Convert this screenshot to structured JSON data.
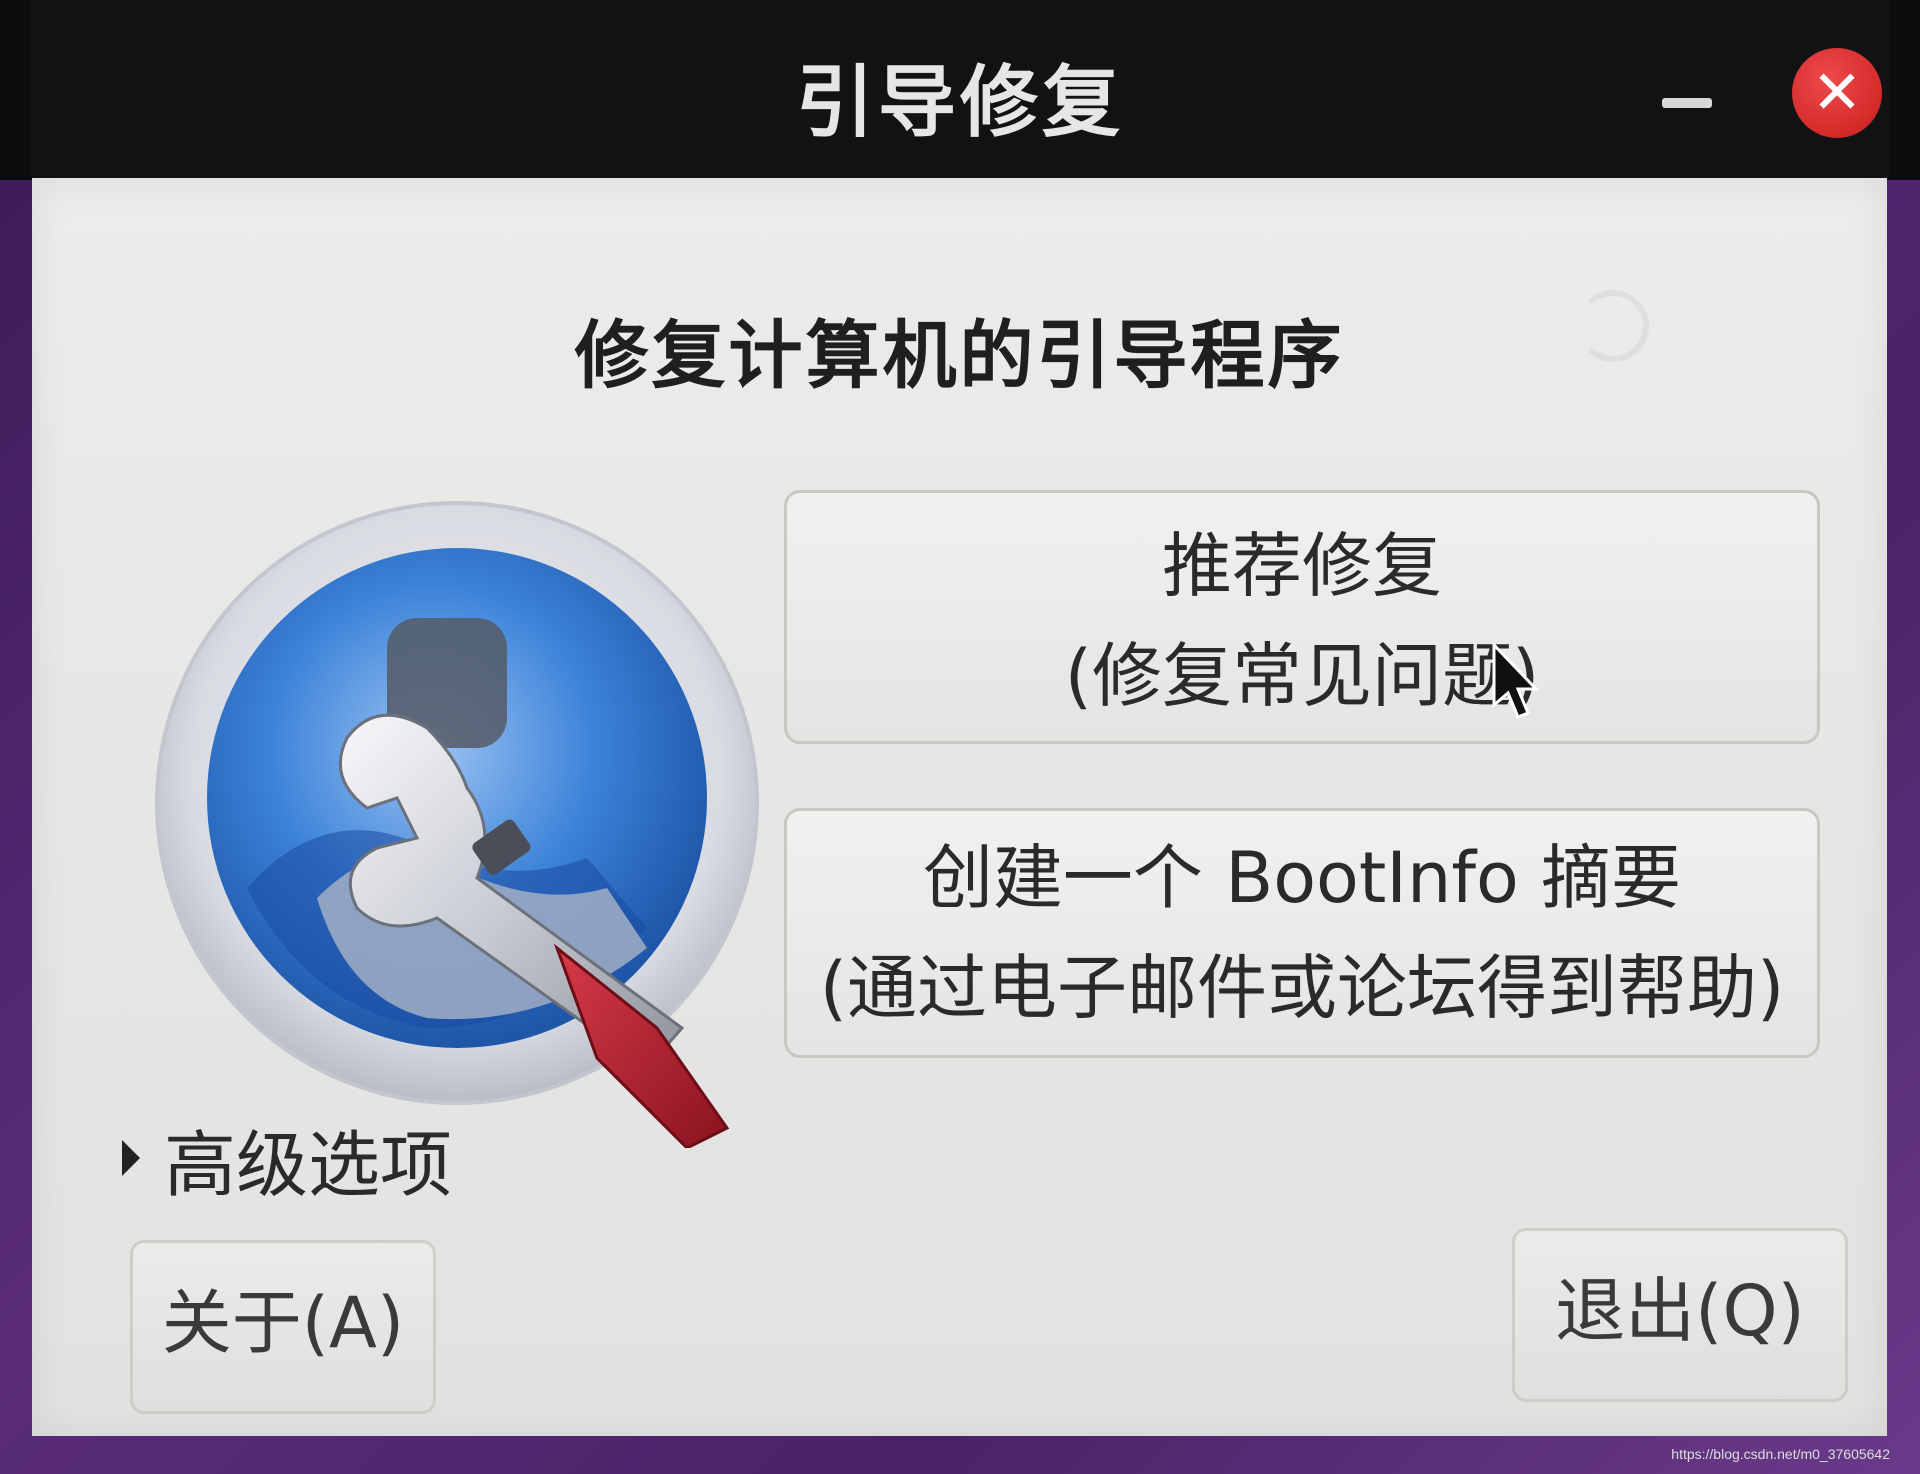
{
  "window": {
    "title": "引导修复"
  },
  "dialog": {
    "heading": "修复计算机的引导程序",
    "recommended_repair": {
      "line1": "推荐修复",
      "line2": "(修复常见问题)"
    },
    "bootinfo_summary": {
      "line1": "创建一个 BootInfo 摘要",
      "line2": "(通过电子邮件或论坛得到帮助)"
    },
    "advanced_options_label": "高级选项",
    "about_label": "关于(A)",
    "quit_label": "退出(Q)"
  },
  "watermark": "https://blog.csdn.net/m0_37605642",
  "icons": {
    "minimize": "minimize-icon",
    "close": "close-icon",
    "app_logo": "wrench-disc-icon",
    "expander": "expander-triangle-icon",
    "spinner": "spinner-icon",
    "cursor": "mouse-cursor-icon"
  },
  "colors": {
    "titlebar": "#121214",
    "close_button": "#d42a2a",
    "dialog_background": "#e6e6e4",
    "wrench_handle": "#b5202e",
    "logo_blue": "#2a6fc9"
  }
}
